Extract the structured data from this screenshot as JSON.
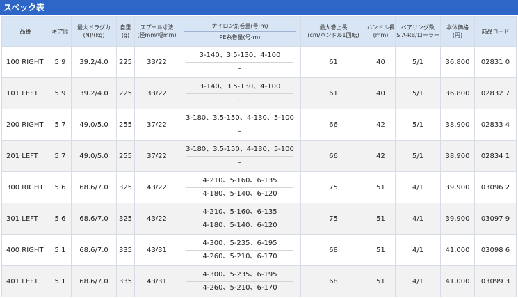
{
  "title": "スペック表",
  "headers": {
    "model": "品番",
    "gear": "ギア比",
    "drag": "最大ドラグカ\n(N)/(kg)",
    "weight": "自重\n(g)",
    "spool": "スプール寸法\n(径mm/幅mm)",
    "line_nylon": "ナイロン糸巻量(号-m)",
    "line_pe": "PE糸巻量(号-m)",
    "retrieve": "最大巻上長\n(cm/ハンドル1回転)",
    "handle": "ハンドル長\n(mm)",
    "bearing": "ベアリング数\nS A-RB/ローラー",
    "price": "本体価格\n(円)",
    "code": "商品コード"
  },
  "rows": [
    {
      "model": "100 RIGHT",
      "gear": "5.9",
      "drag": "39.2/4.0",
      "weight": "225",
      "spool": "33/22",
      "line_upper": "3-140、3.5-130、4-100",
      "line_lower": "–",
      "retrieve": "61",
      "handle": "40",
      "bearing": "5/1",
      "price": "36,800",
      "code": "02831 0"
    },
    {
      "model": "101 LEFT",
      "gear": "5.9",
      "drag": "39.2/4.0",
      "weight": "225",
      "spool": "33/22",
      "line_upper": "3-140、3.5-130、4-100",
      "line_lower": "–",
      "retrieve": "61",
      "handle": "40",
      "bearing": "5/1",
      "price": "36,800",
      "code": "02832 7"
    },
    {
      "model": "200 RIGHT",
      "gear": "5.7",
      "drag": "49.0/5.0",
      "weight": "255",
      "spool": "37/22",
      "line_upper": "3-180、3.5-150、4-130、5-100",
      "line_lower": "–",
      "retrieve": "66",
      "handle": "42",
      "bearing": "5/1",
      "price": "38,900",
      "code": "02833 4"
    },
    {
      "model": "201 LEFT",
      "gear": "5.7",
      "drag": "49.0/5.0",
      "weight": "255",
      "spool": "37/22",
      "line_upper": "3-180、3.5-150、4-130、5-100",
      "line_lower": "–",
      "retrieve": "66",
      "handle": "42",
      "bearing": "5/1",
      "price": "38,900",
      "code": "02834 1"
    },
    {
      "model": "300 RIGHT",
      "gear": "5.6",
      "drag": "68.6/7.0",
      "weight": "325",
      "spool": "43/22",
      "line_upper": "4-210、5-160、6-135",
      "line_lower": "4-180、5-140、6-120",
      "retrieve": "75",
      "handle": "51",
      "bearing": "4/1",
      "price": "39,900",
      "code": "03096 2"
    },
    {
      "model": "301 LEFT",
      "gear": "5.6",
      "drag": "68.6/7.0",
      "weight": "325",
      "spool": "43/22",
      "line_upper": "4-210、5-160、6-135",
      "line_lower": "4-180、5-140、6-120",
      "retrieve": "75",
      "handle": "51",
      "bearing": "4/1",
      "price": "39,900",
      "code": "03097 9"
    },
    {
      "model": "400 RIGHT",
      "gear": "5.1",
      "drag": "68.6/7.0",
      "weight": "335",
      "spool": "43/31",
      "line_upper": "4-300、5-235、6-195",
      "line_lower": "4-260、5-210、6-170",
      "retrieve": "68",
      "handle": "51",
      "bearing": "4/1",
      "price": "41,000",
      "code": "03098 6"
    },
    {
      "model": "401 LEFT",
      "gear": "5.1",
      "drag": "68.6/7.0",
      "weight": "335",
      "spool": "43/31",
      "line_upper": "4-300、5-235、6-195",
      "line_lower": "4-260、5-210、6-170",
      "retrieve": "68",
      "handle": "51",
      "bearing": "4/1",
      "price": "41,000",
      "code": "03099 3"
    }
  ]
}
